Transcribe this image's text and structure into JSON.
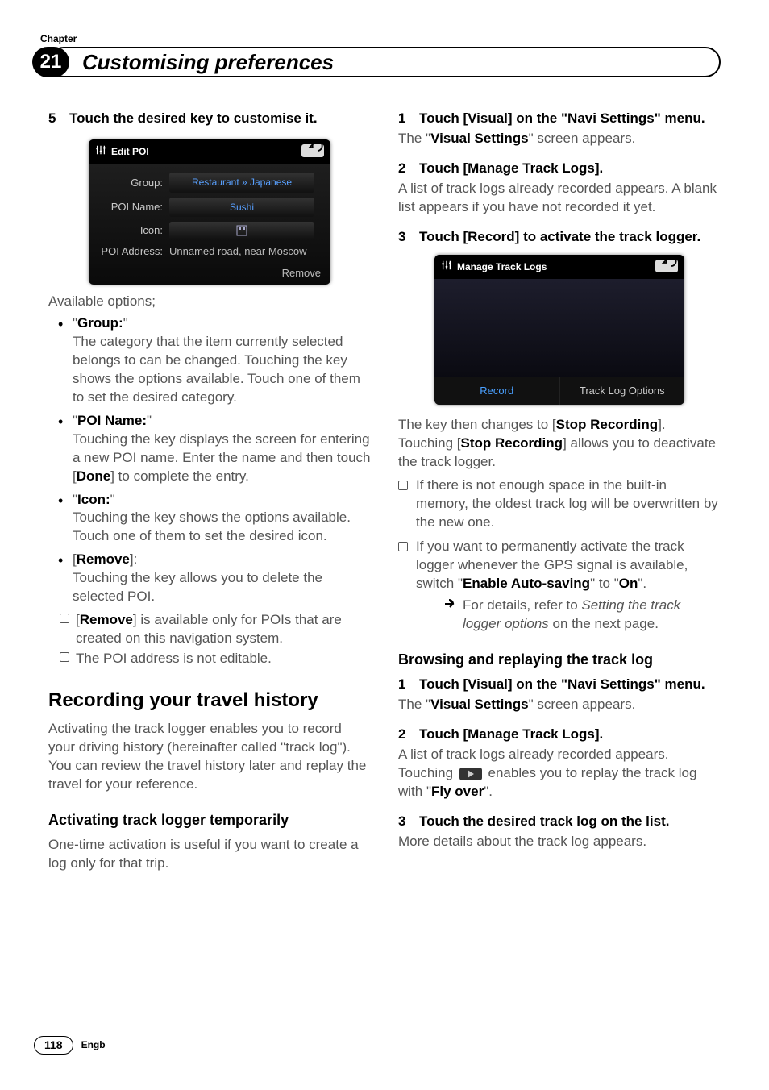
{
  "chapter": {
    "label": "Chapter",
    "num": "21",
    "title": "Customising preferences"
  },
  "left": {
    "step5": {
      "num": "5",
      "text": "Touch the desired key to customise it."
    },
    "ss1": {
      "title": "Edit POI",
      "rows": {
        "group_lbl": "Group:",
        "group_val": "Restaurant » Japanese",
        "name_lbl": "POI Name:",
        "name_val": "Sushi",
        "icon_lbl": "Icon:",
        "addr_lbl": "POI Address:",
        "addr_val": "Unnamed road, near Moscow"
      },
      "remove": "Remove"
    },
    "opts_head": "Available options;",
    "opt_group": {
      "name": "Group:",
      "desc": "The category that the item currently selected belongs to can be changed. Touching the key shows the options available. Touch one of them to set the desired category."
    },
    "opt_name": {
      "name": "POI Name:",
      "desc1": "Touching the key displays the screen for entering a new POI name. Enter the name and then touch [",
      "done": "Done",
      "desc2": "] to complete the entry."
    },
    "opt_icon": {
      "name": "Icon:",
      "desc": "Touching the key shows the options available. Touch one of them to set the desired icon."
    },
    "opt_remove": {
      "name": "Remove",
      "desc": "Touching the key allows you to delete the selected POI."
    },
    "note1a": "[",
    "note1b": "Remove",
    "note1c": "] is available only for POIs that are created on this navigation system.",
    "note2": "The POI address is not editable.",
    "h2": "Recording your travel history",
    "h2_para": "Activating the track logger enables you to record your driving history (hereinafter called \"track log\"). You can review the travel history later and replay the travel for your reference.",
    "h3": "Activating track logger temporarily",
    "h3_para": "One-time activation is useful if you want to create a log only for that trip."
  },
  "right": {
    "step1": {
      "num": "1",
      "text": "Touch [Visual] on the \"Navi Settings\" menu."
    },
    "step1_after_a": "The \"",
    "step1_after_b": "Visual Settings",
    "step1_after_c": "\" screen appears.",
    "step2": {
      "num": "2",
      "text": "Touch [Manage Track Logs]."
    },
    "step2_after": "A list of track logs already recorded appears. A blank list appears if you have not recorded it yet.",
    "step3": {
      "num": "3",
      "text": "Touch [Record] to activate the track logger."
    },
    "ss2": {
      "title": "Manage Track Logs",
      "record": "Record",
      "options": "Track Log Options"
    },
    "after_ss_1": "The key then changes to [",
    "after_ss_2": "Stop Recording",
    "after_ss_3": "]. Touching [",
    "after_ss_4": "Stop Recording",
    "after_ss_5": "] allows you to deactivate the track logger.",
    "sub1": "If there is not enough space in the built-in memory, the oldest track log will be overwritten by the new one.",
    "sub2_a": "If you want to permanently activate the track logger whenever the GPS signal is available, switch \"",
    "sub2_b": "Enable Auto-saving",
    "sub2_c": "\" to \"",
    "sub2_d": "On",
    "sub2_e": "\".",
    "ref_a": "For details, refer to ",
    "ref_b": "Setting the track logger options",
    "ref_c": " on the next page.",
    "h3b": "Browsing and replaying the track log",
    "b_step1": {
      "num": "1",
      "text": "Touch [Visual] on the \"Navi Settings\" menu."
    },
    "b_step1_after_a": "The \"",
    "b_step1_after_b": "Visual Settings",
    "b_step1_after_c": "\" screen appears.",
    "b_step2": {
      "num": "2",
      "text": "Touch [Manage Track Logs]."
    },
    "b_step2_after_a": "A list of track logs already recorded appears. Touching ",
    "b_step2_after_b": " enables you to replay the track log with \"",
    "b_step2_after_c": "Fly over",
    "b_step2_after_d": "\".",
    "b_step3": {
      "num": "3",
      "text": "Touch the desired track log on the list."
    },
    "b_step3_after": "More details about the track log appears."
  },
  "footer": {
    "page": "118",
    "lang": "Engb"
  }
}
